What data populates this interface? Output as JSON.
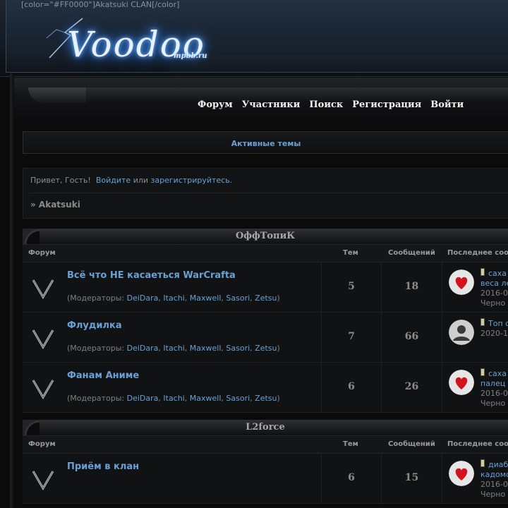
{
  "header": {
    "code_text": "[color=\"#FF0000\"]Akatsuki CLAN[/color]",
    "logo_text": "Voodoo",
    "logo_suffix": "mpbb.ru"
  },
  "nav": {
    "items": [
      "Форум",
      "Участники",
      "Поиск",
      "Регистрация",
      "Войти"
    ]
  },
  "active_topics": "Активные темы",
  "greeting": {
    "prefix": "Привет, Гость!",
    "login": "Войдите",
    "or": "или",
    "register": "зарегистрируйтесь",
    "suffix": "."
  },
  "breadcrumb": "» Akatsuki",
  "table_headers": {
    "forum": "Форум",
    "topics": "Тем",
    "posts": "Сообщений",
    "last": "Последнее соо"
  },
  "moderators_label": "(Модераторы:",
  "moderators": [
    "DeiDara",
    "Itachi",
    "Maxwell",
    "Sasori",
    "Zetsu"
  ],
  "categories": [
    {
      "title": "ОффТопиК",
      "forums": [
        {
          "title": "Всё что НЕ касаеться WarCrafta",
          "topics": "5",
          "posts": "18",
          "avatar": "heart-avatar",
          "last_line1": "саха",
          "last_line2": "веса ле",
          "last_date": "2016-0",
          "last_user": "Черно",
          "has_mods": true
        },
        {
          "title": "Флудилка",
          "topics": "7",
          "posts": "66",
          "avatar": "user-avatar",
          "last_line1": "Топ с",
          "last_line2": "",
          "last_date": "2020-1",
          "last_user": "",
          "has_mods": true
        },
        {
          "title": "Фанам Аниме",
          "topics": "6",
          "posts": "26",
          "avatar": "heart-avatar",
          "last_line1": "саха",
          "last_line2": "палец",
          "last_date": "2016-0",
          "last_user": "Черно",
          "has_mods": true
        }
      ]
    },
    {
      "title": "L2force",
      "forums": [
        {
          "title": "Приём в клан",
          "topics": "6",
          "posts": "15",
          "avatar": "heart-avatar",
          "last_line1": "диаб",
          "last_line2": "кадомо",
          "last_date": "2016-0",
          "last_user": "Черно",
          "has_mods": false
        }
      ]
    }
  ],
  "colors": {
    "link": "#6aa0d6",
    "background": "#0b0b0c",
    "row": "#111213"
  }
}
